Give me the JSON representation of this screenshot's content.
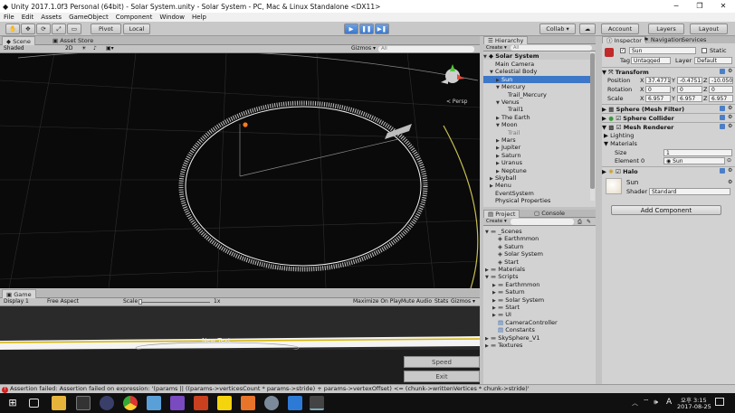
{
  "window": {
    "title": "Unity 2017.1.0f3 Personal (64bit) - Solar System.unity - Solar System - PC, Mac & Linux Standalone <DX11>",
    "minimize": "─",
    "maximize": "❐",
    "close": "✕"
  },
  "menu": [
    "File",
    "Edit",
    "Assets",
    "GameObject",
    "Component",
    "Window",
    "Help"
  ],
  "toolbar": {
    "pivot": "Pivot",
    "local": "Local",
    "collab": "Collab ▾",
    "account": "Account",
    "layers": "Layers",
    "layout": "Layout"
  },
  "scene_tabs": {
    "scene": "Scene",
    "asset_store": "Asset Store"
  },
  "scene_bar": {
    "shaded": "Shaded",
    "mode2d": "2D",
    "gizmos": "Gizmos ▾",
    "search": "All",
    "persp": "< Persp"
  },
  "game_tab": "Game",
  "game_bar": {
    "display": "Display 1",
    "aspect": "Free Aspect",
    "scale": "Scale",
    "scale_value": "1x",
    "maximize": "Maximize On Play",
    "mute": "Mute Audio",
    "stats": "Stats",
    "gizmos": "Gizmos ▾"
  },
  "game_view": {
    "new_text": "New Text",
    "speed": "Speed",
    "exit": "Exit"
  },
  "hierarchy": {
    "tab": "Hierarchy",
    "create": "Create ▾",
    "search": "All",
    "scene_name": "Solar System",
    "items": [
      {
        "label": "Main Camera",
        "indent": 1,
        "arrow": "",
        "selected": false,
        "dim": false
      },
      {
        "label": "Celestial Body",
        "indent": 1,
        "arrow": "▼",
        "selected": false,
        "dim": false
      },
      {
        "label": "Sun",
        "indent": 2,
        "arrow": "▶",
        "selected": true,
        "dim": false
      },
      {
        "label": "Mercury",
        "indent": 2,
        "arrow": "▼",
        "selected": false,
        "dim": false
      },
      {
        "label": "Trail_Mercury",
        "indent": 3,
        "arrow": "",
        "selected": false,
        "dim": false
      },
      {
        "label": "Venus",
        "indent": 2,
        "arrow": "▼",
        "selected": false,
        "dim": false
      },
      {
        "label": "Trail1",
        "indent": 3,
        "arrow": "",
        "selected": false,
        "dim": false
      },
      {
        "label": "The Earth",
        "indent": 2,
        "arrow": "▶",
        "selected": false,
        "dim": false
      },
      {
        "label": "Moon",
        "indent": 2,
        "arrow": "▼",
        "selected": false,
        "dim": false
      },
      {
        "label": "Trail",
        "indent": 3,
        "arrow": "",
        "selected": false,
        "dim": true
      },
      {
        "label": "Mars",
        "indent": 2,
        "arrow": "▶",
        "selected": false,
        "dim": false
      },
      {
        "label": "Jupiter",
        "indent": 2,
        "arrow": "▶",
        "selected": false,
        "dim": false
      },
      {
        "label": "Saturn",
        "indent": 2,
        "arrow": "▶",
        "selected": false,
        "dim": false
      },
      {
        "label": "Uranus",
        "indent": 2,
        "arrow": "▶",
        "selected": false,
        "dim": false
      },
      {
        "label": "Neptune",
        "indent": 2,
        "arrow": "▶",
        "selected": false,
        "dim": false
      },
      {
        "label": "Skyball",
        "indent": 1,
        "arrow": "▶",
        "selected": false,
        "dim": false
      },
      {
        "label": "Menu",
        "indent": 1,
        "arrow": "▶",
        "selected": false,
        "dim": false
      },
      {
        "label": "EventSystem",
        "indent": 1,
        "arrow": "",
        "selected": false,
        "dim": false
      },
      {
        "label": "Physical Properties",
        "indent": 1,
        "arrow": "",
        "selected": false,
        "dim": false
      }
    ]
  },
  "project": {
    "tab": "Project",
    "console": "Console",
    "create": "Create ▾",
    "items": [
      {
        "label": "_Scenes",
        "indent": 0,
        "arrow": "▼",
        "kind": "folder"
      },
      {
        "label": "Earthmmon",
        "indent": 1,
        "arrow": "",
        "kind": "scene"
      },
      {
        "label": "Saturn",
        "indent": 1,
        "arrow": "",
        "kind": "scene"
      },
      {
        "label": "Solar System",
        "indent": 1,
        "arrow": "",
        "kind": "scene"
      },
      {
        "label": "Start",
        "indent": 1,
        "arrow": "",
        "kind": "scene"
      },
      {
        "label": "Materials",
        "indent": 0,
        "arrow": "▶",
        "kind": "folder"
      },
      {
        "label": "Scripts",
        "indent": 0,
        "arrow": "▼",
        "kind": "folder"
      },
      {
        "label": "Earthmmon",
        "indent": 1,
        "arrow": "▶",
        "kind": "folder"
      },
      {
        "label": "Saturn",
        "indent": 1,
        "arrow": "▶",
        "kind": "folder"
      },
      {
        "label": "Solar System",
        "indent": 1,
        "arrow": "▶",
        "kind": "folder"
      },
      {
        "label": "Start",
        "indent": 1,
        "arrow": "▶",
        "kind": "folder"
      },
      {
        "label": "UI",
        "indent": 1,
        "arrow": "▶",
        "kind": "folder"
      },
      {
        "label": "CameraController",
        "indent": 1,
        "arrow": "",
        "kind": "script"
      },
      {
        "label": "Constants",
        "indent": 1,
        "arrow": "",
        "kind": "script"
      },
      {
        "label": "SkySphere_V1",
        "indent": 0,
        "arrow": "▶",
        "kind": "folder"
      },
      {
        "label": "Textures",
        "indent": 0,
        "arrow": "▶",
        "kind": "folder"
      }
    ]
  },
  "inspector": {
    "tabs": [
      "Inspector",
      "Navigation",
      "Services"
    ],
    "name": "Sun",
    "static": "Static",
    "tag_label": "Tag",
    "tag": "Untagged",
    "layer_label": "Layer",
    "layer": "Default",
    "transform": "Transform",
    "position": {
      "label": "Position",
      "x": "37.4771",
      "y": "-0.4751",
      "z": "-10.050"
    },
    "rotation": {
      "label": "Rotation",
      "x": "0",
      "y": "0",
      "z": "0"
    },
    "scale": {
      "label": "Scale",
      "x": "6.957",
      "y": "6.957",
      "z": "6.957"
    },
    "mesh_filter": "Sphere (Mesh Filter)",
    "sphere_collider": "Sphere Collider",
    "mesh_renderer": "Mesh Renderer",
    "lighting": "Lighting",
    "materials": "Materials",
    "size_label": "Size",
    "size": "1",
    "element_label": "Element 0",
    "element": "Sun",
    "halo": "Halo",
    "material_name": "Sun",
    "shader_label": "Shader",
    "shader": "Standard",
    "add_component": "Add Component"
  },
  "error": "Assertion failed: Assertion failed on expression: '(params || ((params->verticesCount * params->stride) + params->vertexOffset) <= (chunk->writtenVertices * chunk->stride)'",
  "taskbar": {
    "lang": "A",
    "time": "오후 3:15",
    "date": "2017-08-25"
  },
  "colors": {
    "selection": "#3d78c8",
    "scene_bg": "#0a0a0a",
    "orbit": "#e8e8e8",
    "sun": "#ff7a1a",
    "error": "#d32020"
  }
}
